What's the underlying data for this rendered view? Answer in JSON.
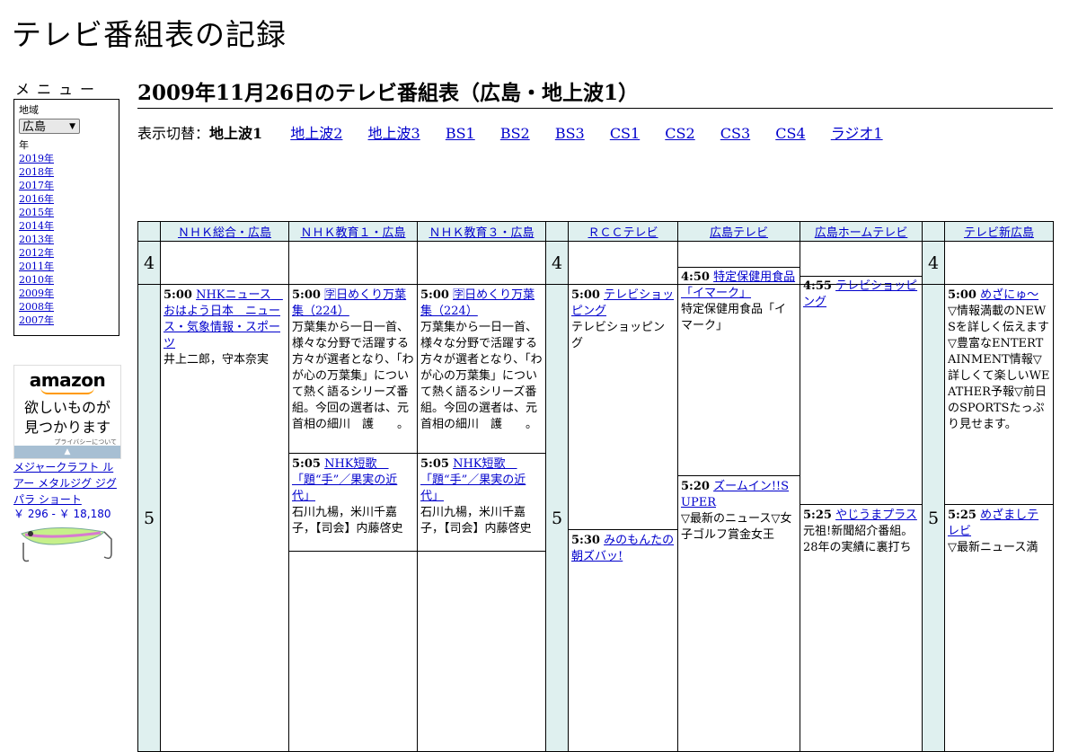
{
  "site_title": "テレビ番組表の記録",
  "sidebar": {
    "menu_heading": "メニュー",
    "region_label": "地域",
    "region_value": "広島",
    "year_label": "年",
    "years": [
      "2019年",
      "2018年",
      "2017年",
      "2016年",
      "2015年",
      "2014年",
      "2013年",
      "2012年",
      "2011年",
      "2010年",
      "2009年",
      "2008年",
      "2007年"
    ]
  },
  "ad": {
    "logo": "amazon",
    "tagline_1": "欲しいものが",
    "tagline_2": "見つかります",
    "privacy": "プライバシーについて",
    "product": "メジャークラフト ルアー メタルジグ ジグパラ ショート",
    "price": "￥ 296 - ￥ 18,180"
  },
  "heading": "2009年11月26日のテレビ番組表（広島・地上波1）",
  "switcher": {
    "label": "表示切替：",
    "current": "地上波1",
    "links": [
      "地上波2",
      "地上波3",
      "BS1",
      "BS2",
      "BS3",
      "CS1",
      "CS2",
      "CS3",
      "CS4",
      "ラジオ1"
    ]
  },
  "channels": [
    "ＮＨＫ総合・広島",
    "ＮＨＫ教育１・広島",
    "ＮＨＫ教育３・広島",
    "ＲＣＣテレビ",
    "広島テレビ",
    "広島ホームテレビ",
    "テレビ新広島"
  ],
  "hours": [
    "4",
    "5"
  ],
  "programs": {
    "nhk_sogo": [
      {
        "time": "5:00",
        "title": "NHKニュース　おはよう日本　ニュース・気象情報・スポーツ",
        "desc": "井上二郎，守本奈実"
      }
    ],
    "nhk_edu1": [
      {
        "time": "5:00",
        "title": "🈑日めくり万葉集（224）",
        "desc": "万葉集から一日一首、様々な分野で活躍する方々が選者となり、「わが心の万葉集」について熱く語るシリーズ番組。今回の選者は、元首相の細川　護　　。"
      },
      {
        "time": "5:05",
        "title": "NHK短歌　「題“手”／果実の近代」",
        "desc": "石川九楊，米川千嘉子，【司会】内藤啓史"
      }
    ],
    "nhk_edu3": [
      {
        "time": "5:00",
        "title": "🈑日めくり万葉集（224）",
        "desc": "万葉集から一日一首、様々な分野で活躍する方々が選者となり、「わが心の万葉集」について熱く語るシリーズ番組。今回の選者は、元首相の細川　護　　。"
      },
      {
        "time": "5:05",
        "title": "NHK短歌　「題“手”／果実の近代」",
        "desc": "石川九楊，米川千嘉子，【司会】内藤啓史"
      }
    ],
    "rcc": [
      {
        "time": "5:00",
        "title": "テレビショッピング",
        "desc": "テレビショッピング"
      },
      {
        "time": "5:30",
        "title": "みのもんたの朝ズバッ!",
        "desc": ""
      }
    ],
    "htv": [
      {
        "time": "4:50",
        "title": "特定保健用食品「イマーク」",
        "desc": "特定保健用食品「イマーク」"
      },
      {
        "time": "5:20",
        "title": "ズームイン!!SUPER",
        "desc": "▽最新のニュース▽女子ゴルフ賞金女王"
      }
    ],
    "home": [
      {
        "time": "4:55",
        "title": "テレビショッピング",
        "desc": ""
      },
      {
        "time": "5:25",
        "title": "やじうまプラス",
        "desc": "元祖!新聞紹介番組。28年の実績に裏打ち"
      }
    ],
    "tss": [
      {
        "time": "5:00",
        "title": "めざにゅ～",
        "desc": "▽情報満載のNEWSを詳しく伝えます▽豊富なENTERTAINMENT情報▽詳しくて楽しいWEATHER予報▽前日のSPORTSたっぷり見せます。"
      },
      {
        "time": "5:25",
        "title": "めざましテレビ",
        "desc": "▽最新ニュース満"
      }
    ]
  }
}
